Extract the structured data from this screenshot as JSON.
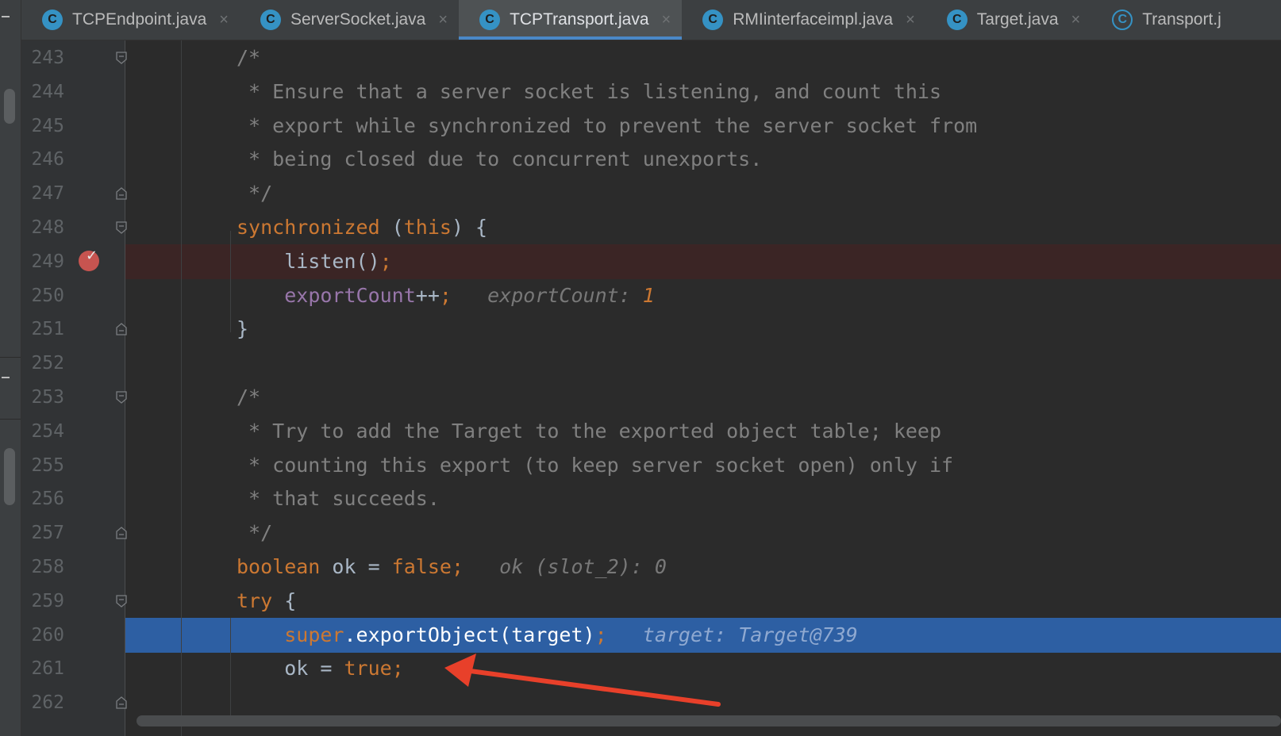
{
  "tabs": [
    {
      "label": "TCPEndpoint.java",
      "icon": "class-icon",
      "active": false
    },
    {
      "label": "ServerSocket.java",
      "icon": "class-icon",
      "active": false
    },
    {
      "label": "TCPTransport.java",
      "icon": "class-icon",
      "active": true
    },
    {
      "label": "RMIinterfaceimpl.java",
      "icon": "class-icon",
      "active": false
    },
    {
      "label": "Target.java",
      "icon": "class-icon",
      "active": false
    },
    {
      "label": "Transport.j",
      "icon": "abstract-class-icon",
      "active": false
    }
  ],
  "icons": {
    "class_glyph": "C",
    "close_glyph": "×",
    "breakpoint_check": "✓"
  },
  "colors": {
    "accent": "#4a88c7",
    "breakpoint": "#c75450",
    "execution_line": "#2d5fa3",
    "keyword": "#cc7832",
    "field": "#9876aa",
    "comment": "#808080"
  },
  "lines": [
    {
      "num": "243",
      "parts": [
        {
          "t": "/*",
          "c": "cmt"
        }
      ]
    },
    {
      "num": "244",
      "parts": [
        {
          "t": " * Ensure that a server socket is listening, and count this",
          "c": "cmt"
        }
      ]
    },
    {
      "num": "245",
      "parts": [
        {
          "t": " * export while synchronized to prevent the server socket from",
          "c": "cmt"
        }
      ]
    },
    {
      "num": "246",
      "parts": [
        {
          "t": " * being closed due to concurrent unexports.",
          "c": "cmt"
        }
      ]
    },
    {
      "num": "247",
      "parts": [
        {
          "t": " */",
          "c": "cmt"
        }
      ]
    },
    {
      "num": "248",
      "parts": [
        {
          "t": "synchronized",
          "c": "kw"
        },
        {
          "t": " (",
          "c": "plain"
        },
        {
          "t": "this",
          "c": "kw"
        },
        {
          "t": ") {",
          "c": "plain"
        }
      ]
    },
    {
      "num": "249",
      "parts": [
        {
          "t": "    listen()",
          "c": "plain"
        },
        {
          "t": ";",
          "c": "kw"
        }
      ]
    },
    {
      "num": "250",
      "parts": [
        {
          "t": "    ",
          "c": "plain"
        },
        {
          "t": "exportCount",
          "c": "fld"
        },
        {
          "t": "++",
          "c": "plain"
        },
        {
          "t": ";",
          "c": "kw"
        },
        {
          "t": "   exportCount: ",
          "c": "hint"
        },
        {
          "t": "1",
          "c": "hint-num"
        }
      ]
    },
    {
      "num": "251",
      "parts": [
        {
          "t": "}",
          "c": "plain"
        }
      ]
    },
    {
      "num": "252",
      "parts": []
    },
    {
      "num": "253",
      "parts": [
        {
          "t": "/*",
          "c": "cmt"
        }
      ]
    },
    {
      "num": "254",
      "parts": [
        {
          "t": " * Try to add the Target to the exported object table; keep",
          "c": "cmt"
        }
      ]
    },
    {
      "num": "255",
      "parts": [
        {
          "t": " * counting this export (to keep server socket open) only if",
          "c": "cmt"
        }
      ]
    },
    {
      "num": "256",
      "parts": [
        {
          "t": " * that succeeds.",
          "c": "cmt"
        }
      ]
    },
    {
      "num": "257",
      "parts": [
        {
          "t": " */",
          "c": "cmt"
        }
      ]
    },
    {
      "num": "258",
      "parts": [
        {
          "t": "boolean",
          "c": "kw"
        },
        {
          "t": " ok = ",
          "c": "plain"
        },
        {
          "t": "false",
          "c": "kw"
        },
        {
          "t": ";",
          "c": "kw"
        },
        {
          "t": "   ok (slot_2): 0",
          "c": "hint"
        }
      ]
    },
    {
      "num": "259",
      "parts": [
        {
          "t": "try",
          "c": "kw"
        },
        {
          "t": " {",
          "c": "plain"
        }
      ]
    },
    {
      "num": "260",
      "parts": [
        {
          "t": "    ",
          "c": "plain"
        },
        {
          "t": "super",
          "c": "kw"
        },
        {
          "t": ".exportObject(target)",
          "c": "plain"
        },
        {
          "t": ";",
          "c": "kw"
        },
        {
          "t": "   target: Target@739",
          "c": "hint"
        }
      ]
    },
    {
      "num": "261",
      "parts": [
        {
          "t": "    ok = ",
          "c": "plain"
        },
        {
          "t": "true",
          "c": "kw"
        },
        {
          "t": ";",
          "c": "kw"
        }
      ]
    },
    {
      "num": "262",
      "parts": []
    }
  ]
}
